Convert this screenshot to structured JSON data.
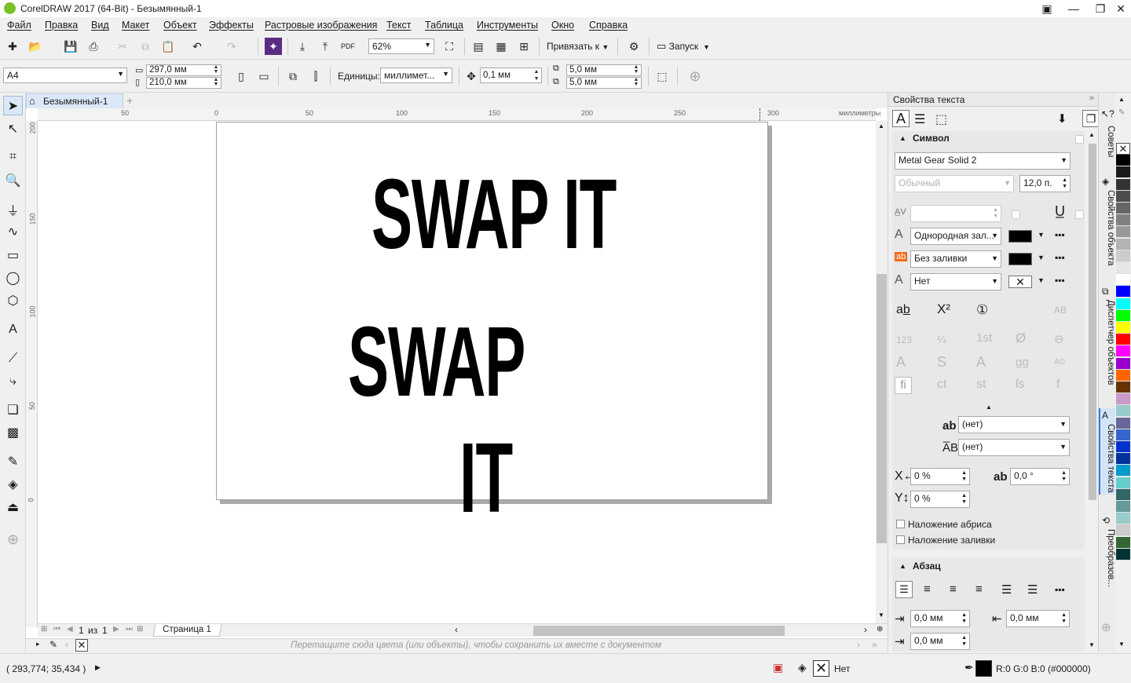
{
  "window": {
    "title": "CorelDRAW 2017 (64-Bit) - Безымянный-1"
  },
  "menu": [
    "Файл",
    "Правка",
    "Вид",
    "Макет",
    "Объект",
    "Эффекты",
    "Растровые изображения",
    "Текст",
    "Таблица",
    "Инструменты",
    "Окно",
    "Справка"
  ],
  "standard_toolbar": {
    "zoom": "62%",
    "snap_label": "Привязать к",
    "launch_label": "Запуск"
  },
  "property_bar": {
    "page_size": "A4",
    "width": "297,0 мм",
    "height": "210,0 мм",
    "units_label": "Единицы:",
    "units_value": "миллимет...",
    "nudge": "0,1 мм",
    "dup_x": "5,0 мм",
    "dup_y": "5,0 мм"
  },
  "document": {
    "tab": "Безымянный-1",
    "ruler_unit": "миллиметры",
    "ruler_h_labels": [
      "50",
      "0",
      "50",
      "100",
      "150",
      "200",
      "250",
      "300"
    ],
    "ruler_v_labels": [
      "200",
      "150",
      "100",
      "50",
      "0"
    ],
    "canvas_text": {
      "line1": "SWAP IT",
      "line2": "SWAP",
      "line3": "IT"
    },
    "page_nav": {
      "current": "1",
      "of_label": "из",
      "total": "1",
      "page_tab": "Страница 1"
    },
    "palette_hint": "Перетащите сюда цвета (или объекты), чтобы сохранить их вместе с документом"
  },
  "status": {
    "coords": "( 293,774; 35,434 )",
    "outline_label": "Нет",
    "fill_label": "R:0 G:0 B:0 (#000000)"
  },
  "docker": {
    "title": "Свойства текста",
    "symbol_section": "Символ",
    "font": "Metal Gear Solid 2",
    "style": "Обычный",
    "size": "12,0 п.",
    "fill_type": "Однородная зал...",
    "bg_fill": "Без заливки",
    "outline": "Нет",
    "none1": "(нет)",
    "none2": "(нет)",
    "x_offset": "0 %",
    "angle": "0,0 °",
    "y_offset": "0 %",
    "overprint_outline": "Наложение абриса",
    "overprint_fill": "Наложение заливки",
    "paragraph_section": "Абзац",
    "indent1": "0,0 мм",
    "indent2": "0,0 мм",
    "indent3": "0,0 мм"
  },
  "vertical_tabs": [
    "Советы",
    "Свойства объекта",
    "Диспетчер объектов",
    "Свойства текста",
    "Преобразов..."
  ],
  "palette_colors": [
    "#ffffff",
    "#000000",
    "#1a1a1a",
    "#333333",
    "#4d4d4d",
    "#666666",
    "#808080",
    "#999999",
    "#b3b3b3",
    "#cccccc",
    "#e6e6e6",
    "#ffffff",
    "#0000ff",
    "#00ffff",
    "#00ff00",
    "#ffff00",
    "#ff0000",
    "#ff00ff",
    "#9900cc",
    "#ff6600",
    "#663300",
    "#cc99cc",
    "#99cccc",
    "#666699",
    "#3366cc",
    "#0033cc",
    "#003399",
    "#0099cc",
    "#66cccc",
    "#336666",
    "#669999",
    "#99cccc",
    "#cccccc",
    "#336633",
    "#003333"
  ]
}
